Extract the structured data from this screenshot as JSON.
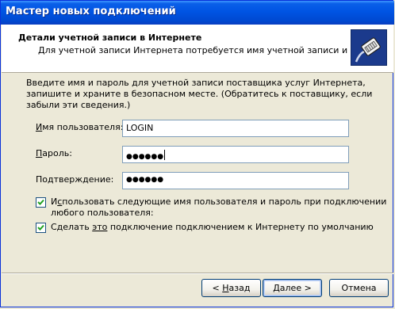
{
  "window": {
    "title": "Мастер новых подключений"
  },
  "header": {
    "title": "Детали учетной записи в Интернете",
    "subtitle": "Для учетной записи Интернета потребуется имя учетной записи и пароль.",
    "icon": "connection-plug-icon"
  },
  "intro_text": "Введите имя и пароль для учетной записи поставщика услуг Интернета, запишите и храните в безопасном месте. (Обратитесь к поставщику, если забыли эти сведения.)",
  "fields": {
    "username": {
      "label_mnemonic": "И",
      "label_rest": "мя пользователя:",
      "value": "LOGIN"
    },
    "password": {
      "label_mnemonic": "П",
      "label_rest": "ароль:",
      "value": "●●●●●●"
    },
    "confirm": {
      "label_prefix": "По",
      "label_mnemonic": "д",
      "label_rest": "тверждение:",
      "value": "●●●●●●"
    }
  },
  "checkboxes": {
    "use_for_all": {
      "checked": true,
      "line1_prefix": "И",
      "line1_mnemonic": "с",
      "line1_rest": "пользовать следующие имя пользователя и пароль при подключении",
      "line2": "любого пользователя:"
    },
    "default_connection": {
      "checked": true,
      "label_prefix": "Сделать ",
      "label_mnemonic": "это",
      "label_rest": " подключение подключением к Интернету по умолчанию"
    }
  },
  "buttons": {
    "back": {
      "arrow": "<",
      "mnemonic": "Н",
      "rest": "азад"
    },
    "next": {
      "mnemonic": "Д",
      "rest": "алее",
      "arrow": ">"
    },
    "cancel": {
      "label": "Отмена"
    }
  }
}
